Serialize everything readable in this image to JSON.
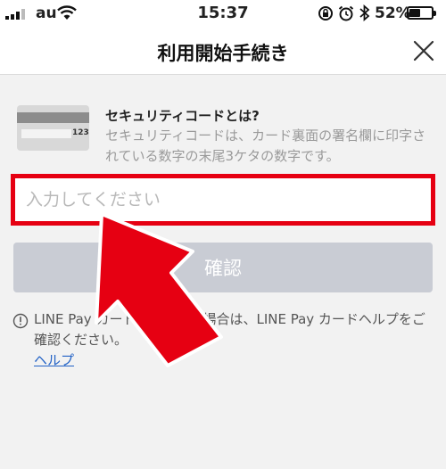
{
  "status_bar": {
    "carrier": "au",
    "time": "15:37",
    "battery_percent": "52%",
    "battery_level": 0.52
  },
  "header": {
    "title": "利用開始手続き"
  },
  "security_info": {
    "title": "セキュリティコードとは?",
    "description": "セキュリティコードは、カード裏面の署名欄に印字されている数字の末尾3ケタの数字です。",
    "card_number": "123"
  },
  "code_input": {
    "placeholder": "入力してください",
    "value": ""
  },
  "confirm_button": {
    "label": "確認"
  },
  "notice": {
    "text": "LINE Pay カード　　　ない場合は、LINE Pay カードヘルプをご確認ください。",
    "help_link": "ヘルプ"
  },
  "colors": {
    "highlight": "#e60012",
    "button_disabled": "#c9ccd4",
    "link": "#2262c6"
  }
}
